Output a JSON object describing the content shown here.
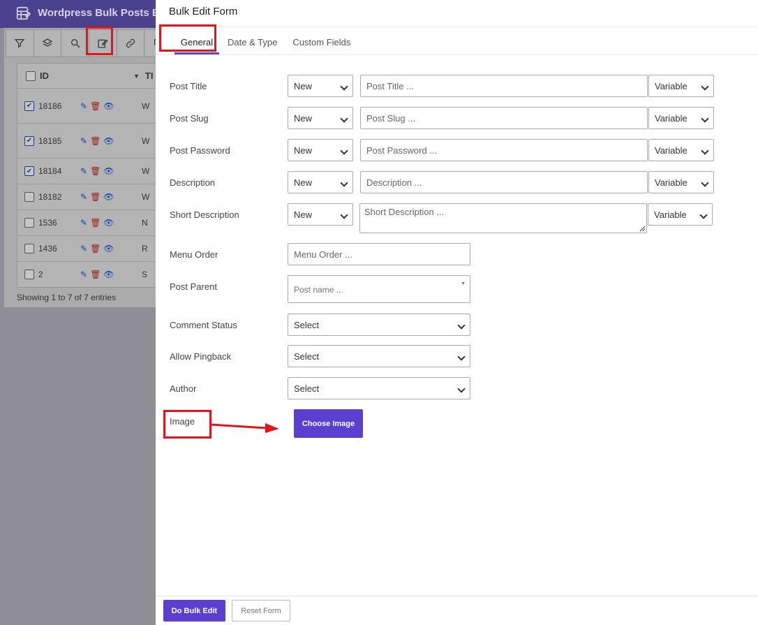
{
  "background": {
    "app_title": "Wordpress Bulk Posts Ed",
    "toolbar_icons": [
      "filter-icon",
      "layers-icon",
      "search-icon",
      "edit-icon",
      "link-icon",
      "duplicate-icon"
    ],
    "table": {
      "id_header": "ID",
      "title_header": "TI",
      "rows": [
        {
          "id": "18186",
          "checked": true,
          "title": "W"
        },
        {
          "id": "18185",
          "checked": true,
          "title": "W"
        },
        {
          "id": "18184",
          "checked": true,
          "title": "W"
        },
        {
          "id": "18182",
          "checked": false,
          "title": "W"
        },
        {
          "id": "1536",
          "checked": false,
          "title": "N"
        },
        {
          "id": "1436",
          "checked": false,
          "title": "R"
        },
        {
          "id": "2",
          "checked": false,
          "title": "S"
        }
      ]
    },
    "footer": "Showing 1 to 7 of 7 entries"
  },
  "panel": {
    "title": "Bulk Edit Form",
    "tabs": [
      {
        "label": "General",
        "active": true
      },
      {
        "label": "Date & Type",
        "active": false
      },
      {
        "label": "Custom Fields",
        "active": false
      }
    ],
    "fields": {
      "post_title": {
        "label": "Post Title",
        "mode": "New",
        "placeholder": "Post Title ...",
        "variable": "Variable"
      },
      "post_slug": {
        "label": "Post Slug",
        "mode": "New",
        "placeholder": "Post Slug ...",
        "variable": "Variable"
      },
      "post_password": {
        "label": "Post Password",
        "mode": "New",
        "placeholder": "Post Password ...",
        "variable": "Variable"
      },
      "description": {
        "label": "Description",
        "mode": "New",
        "placeholder": "Description ...",
        "variable": "Variable"
      },
      "short_description": {
        "label": "Short Description",
        "mode": "New",
        "placeholder": "Short Description ...",
        "variable": "Variable"
      },
      "menu_order": {
        "label": "Menu Order",
        "placeholder": "Menu Order ..."
      },
      "post_parent": {
        "label": "Post Parent",
        "placeholder": "Post name ..."
      },
      "comment_status": {
        "label": "Comment Status",
        "value": "Select"
      },
      "allow_pingback": {
        "label": "Allow Pingback",
        "value": "Select"
      },
      "author": {
        "label": "Author",
        "value": "Select"
      },
      "image": {
        "label": "Image",
        "button": "Choose Image"
      }
    },
    "footer": {
      "do_bulk": "Do Bulk Edit",
      "reset": "Reset Form"
    }
  },
  "colors": {
    "accent": "#5b3fd0",
    "annotation": "#e2151b",
    "header_bg": "#4c418e"
  }
}
